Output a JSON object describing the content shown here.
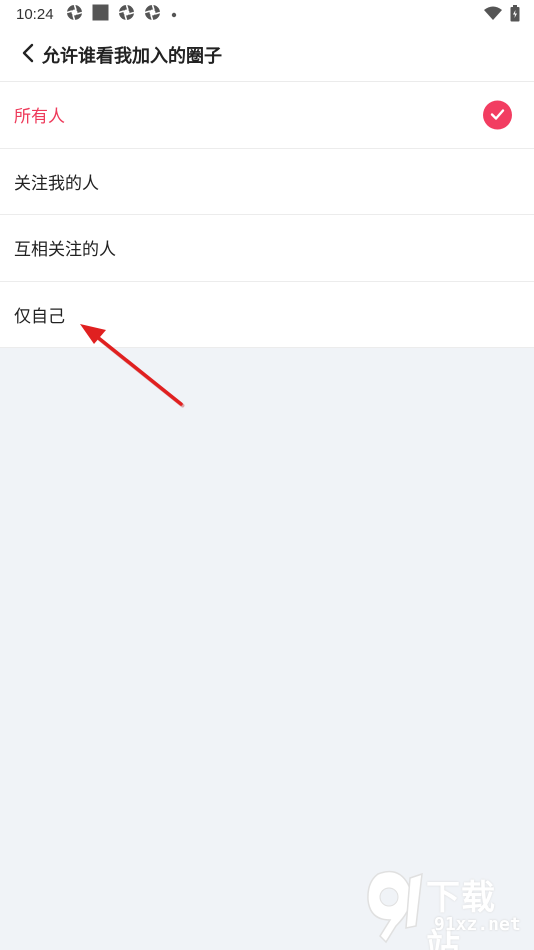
{
  "status_bar": {
    "time": "10:24",
    "left_icons": [
      "aperture-icon",
      "square-icon",
      "aperture-icon",
      "aperture-icon",
      "dot-icon"
    ],
    "right_icons": [
      "wifi-icon",
      "battery-icon"
    ]
  },
  "header": {
    "title": "允许谁看我加入的圈子",
    "back_icon": "chevron-left-icon"
  },
  "options": [
    {
      "label": "所有人",
      "selected": true
    },
    {
      "label": "关注我的人",
      "selected": false
    },
    {
      "label": "互相关注的人",
      "selected": false
    },
    {
      "label": "仅自己",
      "selected": false
    }
  ],
  "colors": {
    "accent": "#f23d61",
    "selected_text": "#ee3a5a",
    "arrow": "#e02020",
    "background": "#f0f3f7"
  },
  "watermark": {
    "text": "下载站",
    "url": "91xz.net"
  }
}
